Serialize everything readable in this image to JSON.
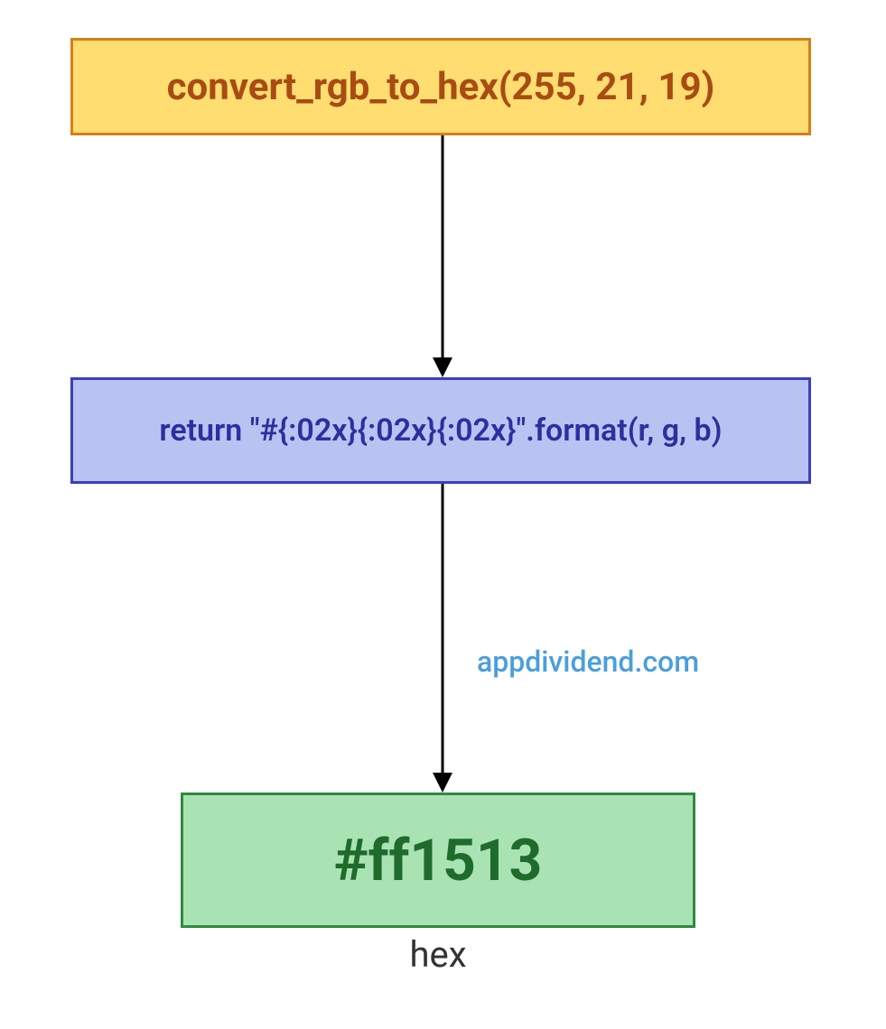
{
  "nodes": {
    "top": {
      "label": "convert_rgb_to_hex(255, 21, 19)",
      "bg": "#ffdd71",
      "border": "#d67f18",
      "text_color": "#a84c14"
    },
    "mid": {
      "label": "return \"#{:02x}{:02x}{:02x}\".format(r, g, b)",
      "bg": "#b9c3f2",
      "border": "#3d3fbf",
      "text_color": "#2f2e9e"
    },
    "bot": {
      "label": "#ff1513",
      "caption": "hex",
      "bg": "#a9e3b4",
      "border": "#2f8b3d",
      "text_color": "#1f6b2c"
    }
  },
  "watermark": "appdividend.com"
}
